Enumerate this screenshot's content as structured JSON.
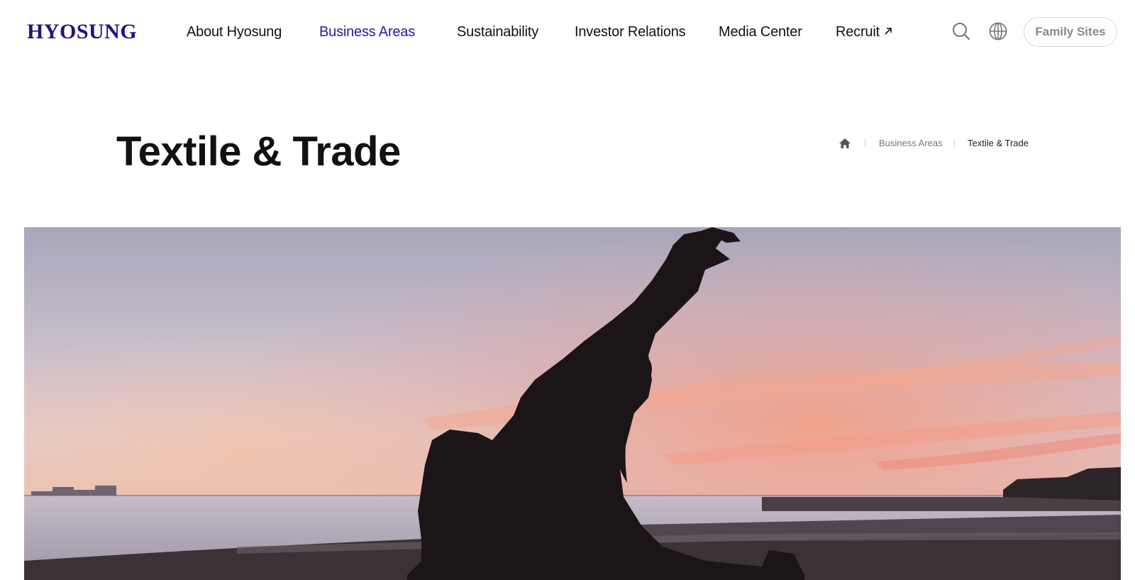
{
  "header": {
    "logo": "HYOSUNG",
    "nav": [
      {
        "label": "About Hyosung"
      },
      {
        "label": "Business Areas"
      },
      {
        "label": "Sustainability"
      },
      {
        "label": "Investor Relations"
      },
      {
        "label": "Media Center"
      },
      {
        "label": "Recruit"
      }
    ],
    "family_sites_label": "Family Sites",
    "search_icon": "search-icon",
    "language_icon": "globe-icon",
    "external_link_icon": "arrow-up-right-icon"
  },
  "page": {
    "title": "Textile & Trade"
  },
  "breadcrumb": {
    "home_icon": "home-icon",
    "items": [
      {
        "label": "Business Areas"
      },
      {
        "label": "Textile & Trade"
      }
    ]
  },
  "hero": {
    "image": "silhouette of woman in yoga pose against sunset sky over the sea"
  },
  "colors": {
    "brand": "#1f1383",
    "active_nav": "#2a1a9a",
    "text": "#111111",
    "muted": "#777777"
  }
}
